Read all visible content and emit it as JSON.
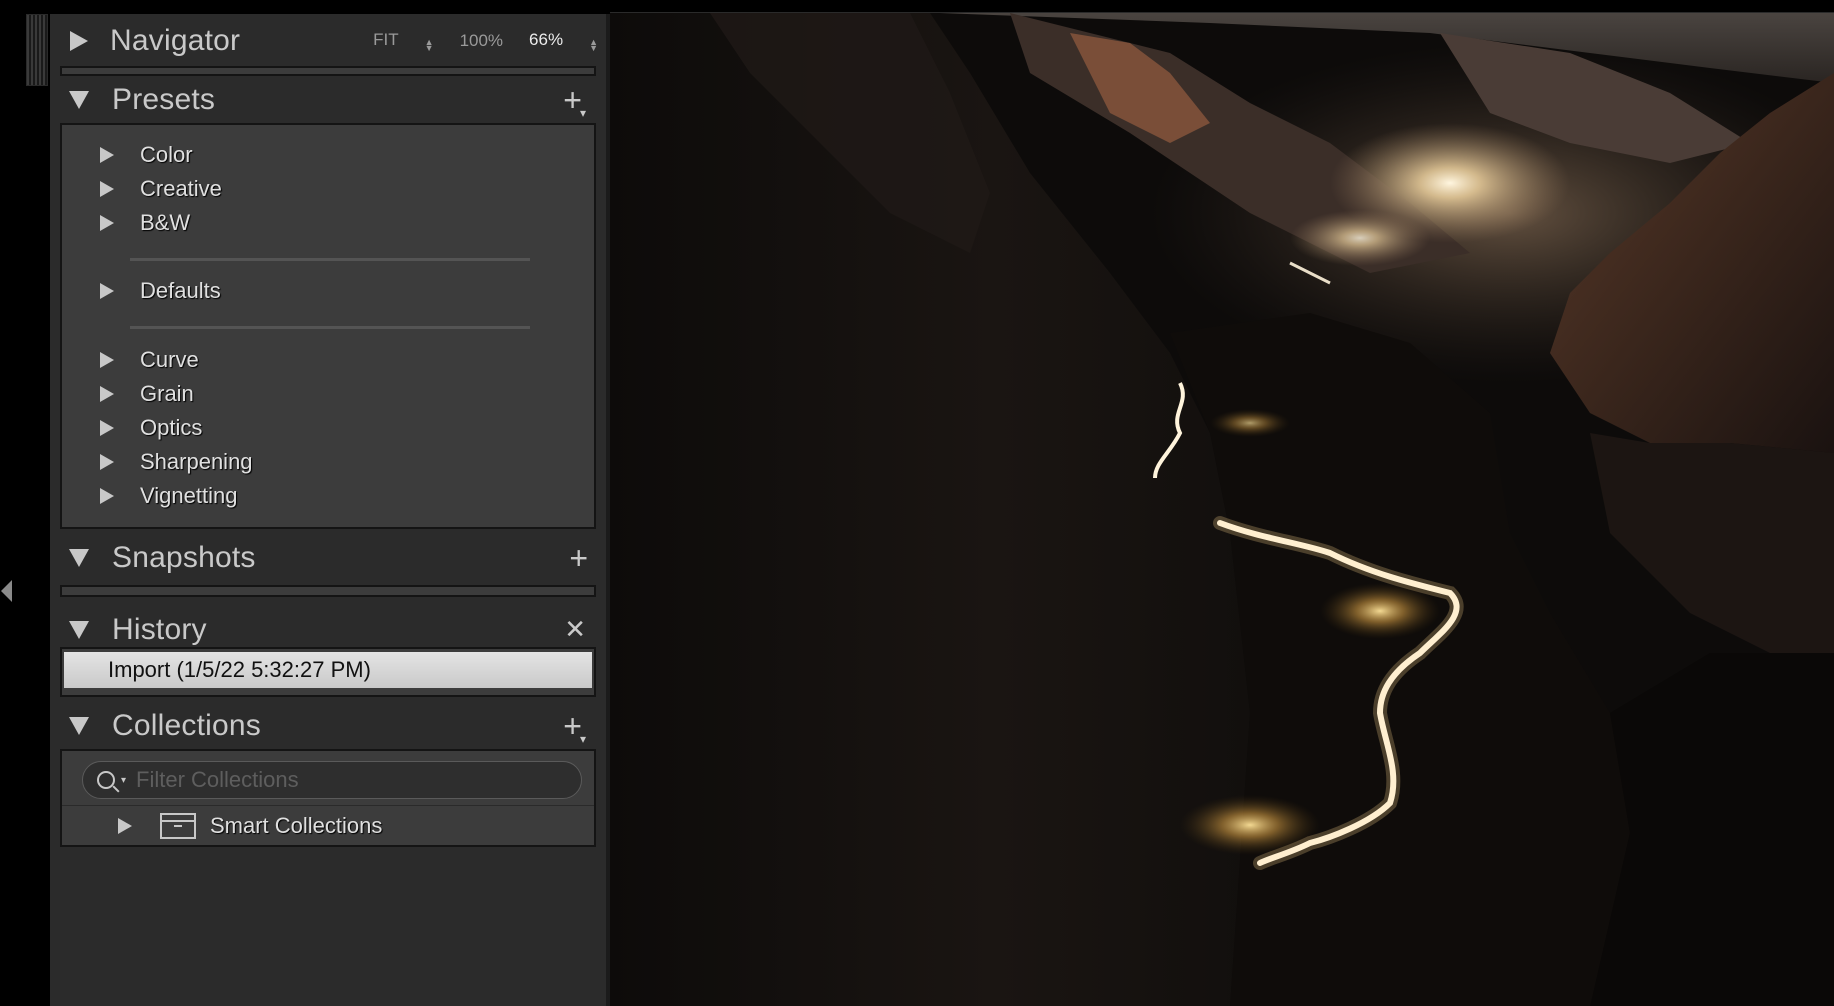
{
  "navigator": {
    "title": "Navigator",
    "zoom_fit": "FIT",
    "zoom_100": "100%",
    "zoom_current": "66%"
  },
  "presets": {
    "title": "Presets",
    "groups": [
      "Color",
      "Creative",
      "B&W",
      "Defaults",
      "Curve",
      "Grain",
      "Optics",
      "Sharpening",
      "Vignetting"
    ]
  },
  "snapshots": {
    "title": "Snapshots"
  },
  "history": {
    "title": "History",
    "items": [
      "Import (1/5/22 5:32:27 PM)"
    ]
  },
  "collections": {
    "title": "Collections",
    "filter_placeholder": "Filter Collections",
    "items": [
      "Smart Collections"
    ]
  },
  "icons": {
    "add": "plus-icon",
    "clear": "close-icon",
    "search": "search-icon",
    "collection_set": "collection-set-icon"
  },
  "colors": {
    "panel_bg": "#2b2b2b",
    "content_bg": "#3c3c3c",
    "text": "#c9c9c9",
    "selected_row": "#d6d6d6"
  }
}
